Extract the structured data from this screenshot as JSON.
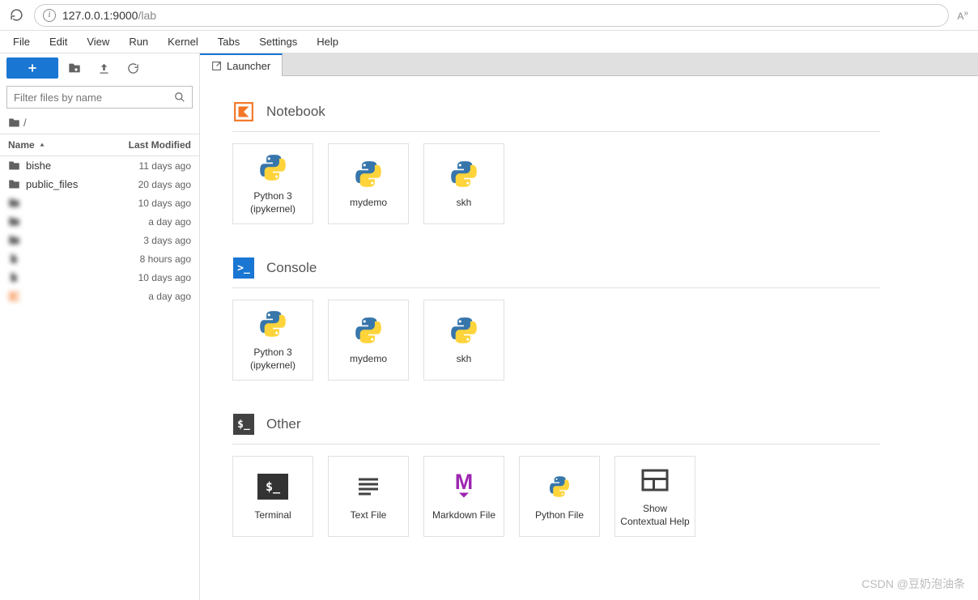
{
  "browser": {
    "url_host": "127.0.0.1",
    "url_port": ":9000",
    "url_path": "/lab"
  },
  "menu": [
    "File",
    "Edit",
    "View",
    "Run",
    "Kernel",
    "Tabs",
    "Settings",
    "Help"
  ],
  "sidebar": {
    "filter_placeholder": "Filter files by name",
    "breadcrumb": "/",
    "header_name": "Name",
    "header_modified": "Last Modified",
    "files": [
      {
        "name": "bishe",
        "modified": "11 days ago",
        "icon": "folder",
        "blur": false
      },
      {
        "name": "public_files",
        "modified": "20 days ago",
        "icon": "folder",
        "blur": false
      },
      {
        "name": "",
        "modified": "10 days ago",
        "icon": "folder",
        "blur": true
      },
      {
        "name": "",
        "modified": "a day ago",
        "icon": "folder",
        "blur": true
      },
      {
        "name": "",
        "modified": "3 days ago",
        "icon": "folder",
        "blur": true
      },
      {
        "name": "",
        "modified": "8 hours ago",
        "icon": "file",
        "blur": true
      },
      {
        "name": "",
        "modified": "10 days ago",
        "icon": "file",
        "blur": true
      },
      {
        "name": "",
        "modified": "a day ago",
        "icon": "notebook",
        "blur": true
      }
    ]
  },
  "tab": {
    "label": "Launcher"
  },
  "launcher": {
    "sections": [
      {
        "key": "notebook",
        "title": "Notebook",
        "icon": "notebook-section",
        "cards": [
          {
            "label": "Python 3 (ipykernel)",
            "icon": "python"
          },
          {
            "label": "mydemo",
            "icon": "python"
          },
          {
            "label": "skh",
            "icon": "python"
          }
        ]
      },
      {
        "key": "console",
        "title": "Console",
        "icon": "console-section",
        "cards": [
          {
            "label": "Python 3 (ipykernel)",
            "icon": "python"
          },
          {
            "label": "mydemo",
            "icon": "python"
          },
          {
            "label": "skh",
            "icon": "python"
          }
        ]
      },
      {
        "key": "other",
        "title": "Other",
        "icon": "other-section",
        "cards": [
          {
            "label": "Terminal",
            "icon": "terminal"
          },
          {
            "label": "Text File",
            "icon": "textfile"
          },
          {
            "label": "Markdown File",
            "icon": "markdown"
          },
          {
            "label": "Python File",
            "icon": "pyfile"
          },
          {
            "label": "Show Contextual Help",
            "icon": "help"
          }
        ]
      }
    ]
  },
  "watermark": "CSDN @豆奶泡油条"
}
